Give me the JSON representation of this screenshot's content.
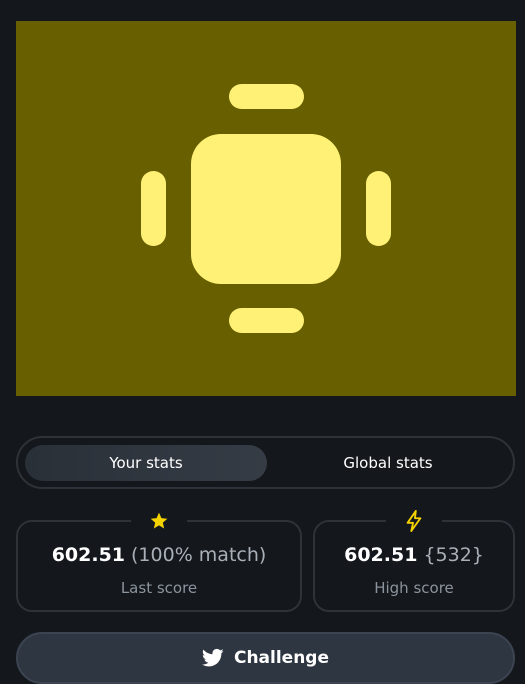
{
  "artwork": {
    "background": "#686000",
    "glyph_color": "#fff176",
    "icon": "smartwatch-icon"
  },
  "stats_toggle": {
    "your_label": "Your stats",
    "global_label": "Global stats",
    "active": "your"
  },
  "last_score": {
    "value": "602.51",
    "detail": "(100% match)",
    "label": "Last score",
    "icon": "star-icon",
    "icon_color": "#f5d300"
  },
  "high_score": {
    "value": "602.51",
    "detail": "{532}",
    "label": "High score",
    "icon": "lightning-icon",
    "icon_color": "#f5d300"
  },
  "challenge": {
    "label": "Challenge",
    "icon": "twitter-icon"
  }
}
